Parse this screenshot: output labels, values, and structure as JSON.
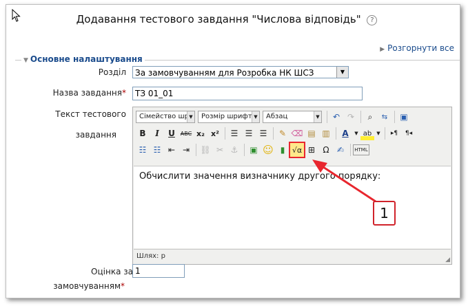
{
  "page": {
    "title": "Додавання тестового завдання \"Числова відповідь\"",
    "help": "?",
    "expand_all": "Розгорнути все"
  },
  "section": {
    "legend": "Основне налаштування"
  },
  "fields": {
    "category_label": "Розділ",
    "category_value": "За замовчуванням для Розробка НК ШСЗ",
    "name_label": "Назва завдання",
    "name_value": "ТЗ 01_01",
    "text_label_1": "Текст тестового",
    "text_label_2": "завдання",
    "grade_label_1": "Оцінка за",
    "grade_label_2": "замовчуванням",
    "grade_value": "1",
    "required_mark": "*"
  },
  "editor": {
    "font_family": "Сімейство шрифтів",
    "font_size": "Розмір шрифта",
    "format": "Абзац",
    "content": "Обчислити значення визначнику другого порядку:",
    "path": "Шлях: p",
    "row2_bold": "B",
    "row2_italic": "I",
    "row2_underline": "U",
    "row2_strike": "ABC",
    "row2_sub": "x₂",
    "row2_sup": "x²",
    "omega": "Ω",
    "html": "HTML"
  },
  "annotation": {
    "callout": "1"
  },
  "colors": {
    "accent": "#1a4b8c",
    "required": "#aa0000",
    "annotation": "#e8262e"
  }
}
